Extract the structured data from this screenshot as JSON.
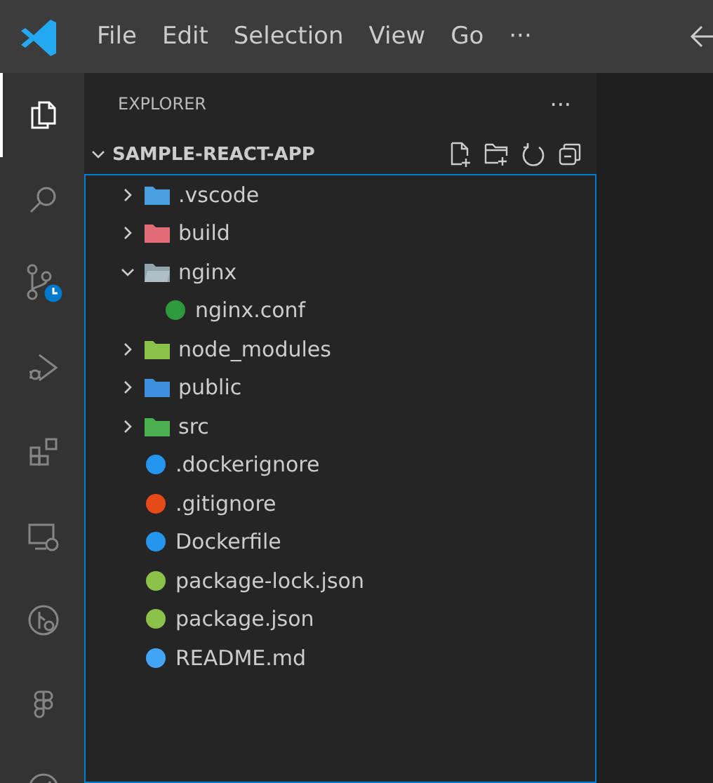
{
  "menu": [
    "File",
    "Edit",
    "Selection",
    "View",
    "Go",
    "···"
  ],
  "activity_bar": [
    {
      "selected": true
    },
    {
      "selected": false
    },
    {
      "selected": false
    },
    {
      "selected": false
    },
    {
      "selected": false
    },
    {
      "selected": false
    },
    {
      "selected": false
    },
    {
      "selected": false
    },
    {
      "selected": false
    }
  ],
  "sidebar": {
    "title": "EXPLORER",
    "more": "···",
    "folder": {
      "name": "SAMPLE-REACT-APP",
      "expanded": true
    }
  },
  "tree": [
    {
      "name": ".vscode",
      "kind": "folder",
      "expanded": false,
      "color": "#4a9fe0"
    },
    {
      "name": "build",
      "kind": "folder",
      "expanded": false,
      "color": "#e06c75"
    },
    {
      "name": "nginx",
      "kind": "folder",
      "expanded": true,
      "color": "#90a4ae",
      "children": [
        {
          "name": "nginx.conf",
          "kind": "file",
          "color": "#2e9a3e"
        }
      ]
    },
    {
      "name": "node_modules",
      "kind": "folder",
      "expanded": false,
      "color": "#8bc34a"
    },
    {
      "name": "public",
      "kind": "folder",
      "expanded": false,
      "color": "#3f8fdf"
    },
    {
      "name": "src",
      "kind": "folder",
      "expanded": false,
      "color": "#4caf50"
    },
    {
      "name": ".dockerignore",
      "kind": "file",
      "color": "#2496ed"
    },
    {
      "name": ".gitignore",
      "kind": "file",
      "color": "#e64a19"
    },
    {
      "name": "Dockerfile",
      "kind": "file",
      "color": "#2496ed"
    },
    {
      "name": "package-lock.json",
      "kind": "file",
      "color": "#8bc34a"
    },
    {
      "name": "package.json",
      "kind": "file",
      "color": "#8bc34a"
    },
    {
      "name": "README.md",
      "kind": "file",
      "color": "#42a5f5"
    }
  ]
}
